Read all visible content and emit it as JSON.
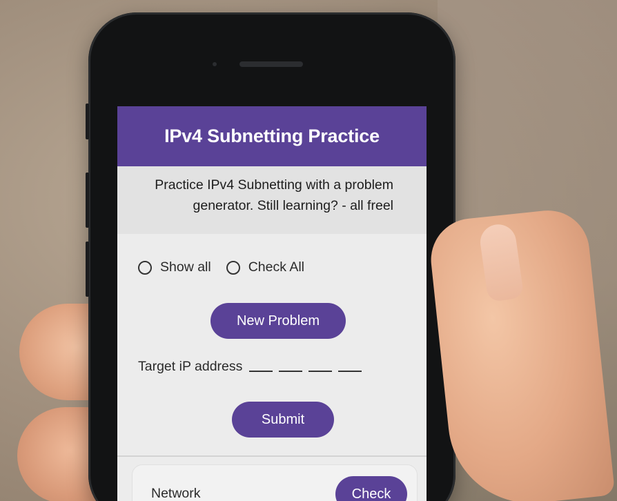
{
  "app": {
    "title": "IPv4 Subnetting Practice",
    "intro_line1": "Practice IPv4 Subnetting with a problem",
    "intro_line2": "generator. Still learning? - all freel"
  },
  "options": {
    "show_all_label": "Show all",
    "check_all_label": "Check All"
  },
  "actions": {
    "new_problem_label": "New Problem",
    "submit_label": "Submit"
  },
  "target": {
    "label": "Target iP address"
  },
  "network_card": {
    "label": "Network",
    "check_label": "Check"
  },
  "colors": {
    "accent": "#5a4297",
    "screen_bg": "#ececec"
  }
}
